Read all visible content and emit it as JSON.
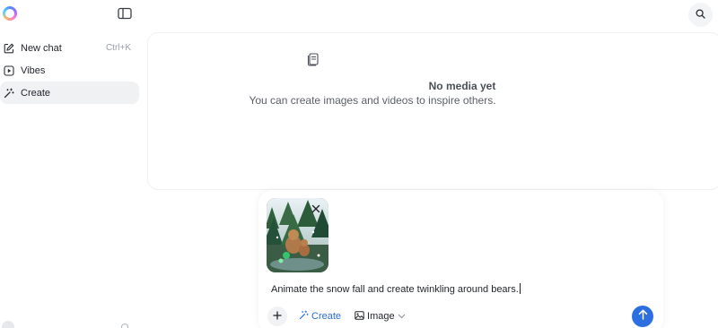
{
  "sidebar": {
    "items": [
      {
        "label": "New chat",
        "shortcut": "Ctrl+K",
        "icon": "edit-icon"
      },
      {
        "label": "Vibes",
        "icon": "play-square-icon"
      },
      {
        "label": "Create",
        "icon": "magic-wand-icon"
      }
    ]
  },
  "main": {
    "empty_title": "No media yet",
    "empty_subtitle": "You can create images and videos to inspire others."
  },
  "composer": {
    "prompt": "Animate the snow fall and create twinkling around bears.",
    "create_label": "Create",
    "image_label": "Image"
  },
  "colors": {
    "accent": "#2d6fe0",
    "create_text": "#2a6fdb",
    "active_item_bg": "#f0f1f3"
  }
}
